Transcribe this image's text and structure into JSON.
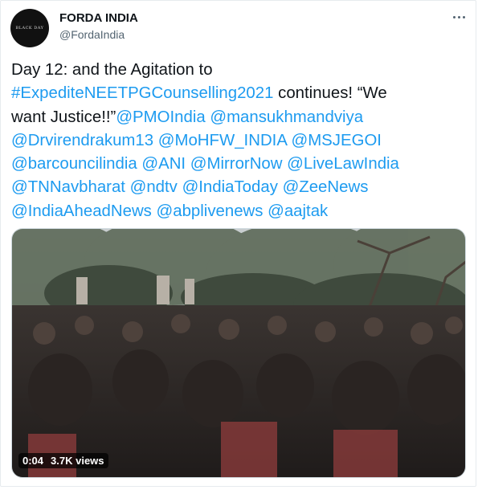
{
  "author": {
    "display_name": "FORDA INDIA",
    "handle": "@FordaIndia",
    "avatar_text": "BLACK DAY"
  },
  "tweet": {
    "lines": [
      [
        {
          "text": "Day 12: and the Agitation to",
          "link": false
        }
      ],
      [
        {
          "text": "#ExpediteNEETPGCounselling2021",
          "link": true
        },
        {
          "text": " continues! “We",
          "link": false
        }
      ],
      [
        {
          "text": "want Justice!!”",
          "link": false
        },
        {
          "text": "@PMOIndia",
          "link": true
        },
        {
          "text": " ",
          "link": false
        },
        {
          "text": "@mansukhmandviya",
          "link": true
        }
      ],
      [
        {
          "text": "@Drvirendrakum13",
          "link": true
        },
        {
          "text": " ",
          "link": false
        },
        {
          "text": "@MoHFW_INDIA",
          "link": true
        },
        {
          "text": " ",
          "link": false
        },
        {
          "text": "@MSJEGOI",
          "link": true
        }
      ],
      [
        {
          "text": "@barcouncilindia",
          "link": true
        },
        {
          "text": " ",
          "link": false
        },
        {
          "text": "@ANI",
          "link": true
        },
        {
          "text": " ",
          "link": false
        },
        {
          "text": "@MirrorNow",
          "link": true
        },
        {
          "text": " ",
          "link": false
        },
        {
          "text": "@LiveLawIndia",
          "link": true
        }
      ],
      [
        {
          "text": "@TNNavbharat",
          "link": true
        },
        {
          "text": " ",
          "link": false
        },
        {
          "text": "@ndtv",
          "link": true
        },
        {
          "text": " ",
          "link": false
        },
        {
          "text": "@IndiaToday",
          "link": true
        },
        {
          "text": " ",
          "link": false
        },
        {
          "text": "@ZeeNews",
          "link": true
        }
      ],
      [
        {
          "text": "@IndiaAheadNews",
          "link": true
        },
        {
          "text": " ",
          "link": false
        },
        {
          "text": "@abplivenews",
          "link": true
        },
        {
          "text": " ",
          "link": false
        },
        {
          "text": "@aajtak",
          "link": true
        }
      ]
    ]
  },
  "video": {
    "duration": "0:04",
    "views": "3.7K views"
  },
  "colors": {
    "link": "#1d9bf0",
    "text": "#0f1419",
    "secondary": "#536471"
  },
  "icons": {
    "more": "more-options-icon"
  }
}
